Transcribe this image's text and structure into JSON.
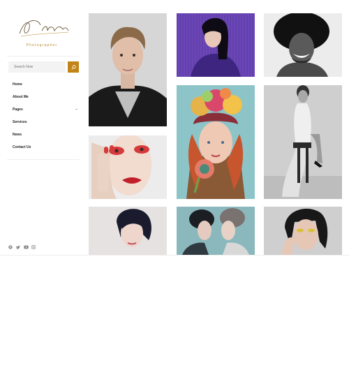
{
  "brand": {
    "script": "Photo by ranking",
    "subtitle": "Photographer"
  },
  "search": {
    "placeholder": "Search Now"
  },
  "nav": [
    {
      "label": "Home"
    },
    {
      "label": "About Me"
    },
    {
      "label": "Pages",
      "has_submenu": true
    },
    {
      "label": "Services"
    },
    {
      "label": "News"
    },
    {
      "label": "Contact Us"
    }
  ],
  "social": [
    "facebook-icon",
    "twitter-icon",
    "youtube-icon",
    "instagram-icon"
  ],
  "colors": {
    "accent": "#c28417",
    "brand_text": "#b58a2a"
  },
  "gallery": [
    {
      "name": "portrait-man-blonde"
    },
    {
      "name": "portrait-woman-purple"
    },
    {
      "name": "portrait-man-afro"
    },
    {
      "name": "portrait-woman-red-makeup"
    },
    {
      "name": "portrait-woman-flower-hat"
    },
    {
      "name": "portrait-woman-chair"
    },
    {
      "name": "portrait-woman-bob"
    },
    {
      "name": "portrait-two-women"
    },
    {
      "name": "portrait-woman-yellow-eyeshadow"
    }
  ]
}
